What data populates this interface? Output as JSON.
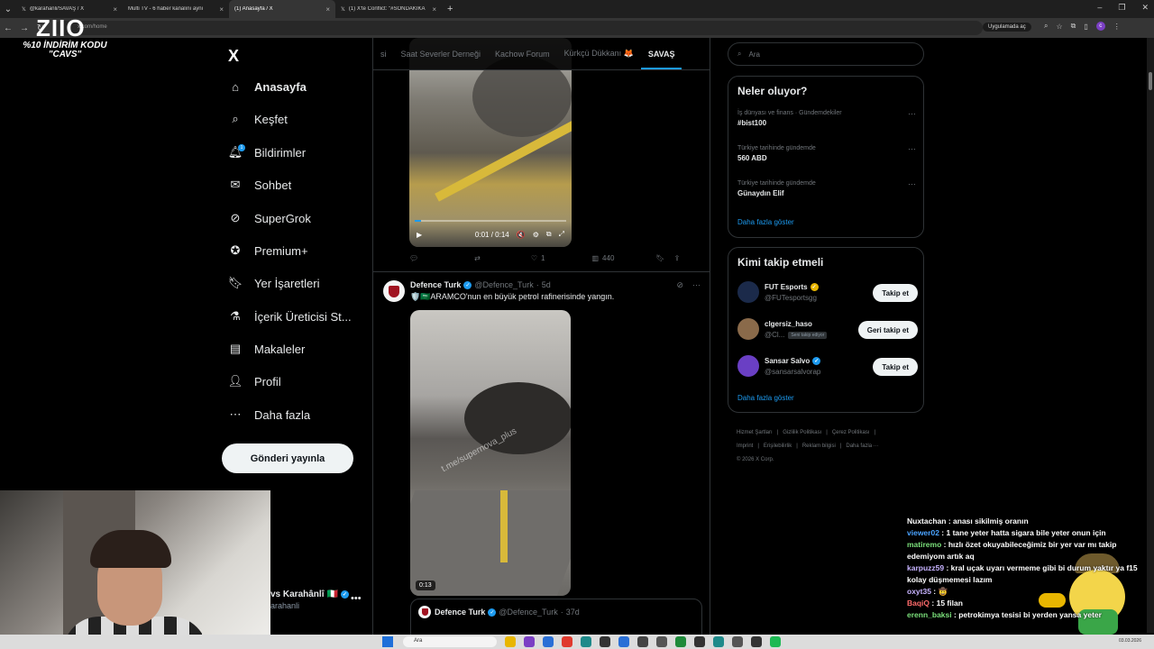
{
  "browser": {
    "tabs": [
      {
        "title": "@karahanli/SAVAŞ / X",
        "active": false
      },
      {
        "title": "Multi TV - 6 haber kanalını aynı",
        "active": false
      },
      {
        "title": "(1) Anasayfa / X",
        "active": true
      },
      {
        "title": "(1) X'te Conflict: \"#SONDAKİKA",
        "active": false
      }
    ],
    "new_tab": "+",
    "address": "x.com/home",
    "app_button": "Uygulamada aç"
  },
  "overlay": {
    "logo_text": "ZIIO",
    "promo_line1": "%10 İNDİRİM KODU",
    "promo_line2": "\"CAVS\""
  },
  "nav": {
    "logo": "X",
    "items": [
      {
        "label": "Anasayfa",
        "icon": "home-icon",
        "bold": true
      },
      {
        "label": "Keşfet",
        "icon": "search-icon"
      },
      {
        "label": "Bildirimler",
        "icon": "bell-icon"
      },
      {
        "label": "Sohbet",
        "icon": "mail-icon"
      },
      {
        "label": "SuperGrok",
        "icon": "grok-icon"
      },
      {
        "label": "Premium+",
        "icon": "premium-icon"
      },
      {
        "label": "Yer İşaretleri",
        "icon": "bookmark-icon"
      },
      {
        "label": "İçerik Üreticisi St...",
        "icon": "flask-icon"
      },
      {
        "label": "Makaleler",
        "icon": "article-icon"
      },
      {
        "label": "Profil",
        "icon": "person-icon"
      },
      {
        "label": "Daha fazla",
        "icon": "more-circle-icon"
      }
    ],
    "notifications_badge": "1",
    "post_button": "Gönderi yayınla",
    "account_name": "vs Karahânlî",
    "account_handle": "arahanli"
  },
  "timeline": {
    "tabs": [
      "si",
      "Saat Severler Derneği",
      "Kachow Forum",
      "Kürkçü Dükkanı 🦊",
      "SAVAŞ"
    ],
    "active_tab": "SAVAŞ",
    "video1": {
      "time": "0:01 / 0:14",
      "progress": 0.04
    },
    "actions1": {
      "retweets": "",
      "likes": "1",
      "views": "440"
    },
    "tweet2": {
      "author": "Defence Turk",
      "handle": "@Defence_Turk",
      "age": "5d",
      "text": "🛡️🇸🇦ARAMCO'nun en büyük petrol rafinerisinde yangın.",
      "watermark": "t.me/supernova_plus",
      "duration": "0:13"
    },
    "quote": {
      "author": "Defence Turk",
      "handle": "@Defence_Turk",
      "age": "37d"
    }
  },
  "sidebar": {
    "search_placeholder": "Ara",
    "trends_title": "Neler oluyor?",
    "trends": [
      {
        "context": "İş dünyası ve finans · Gündemdekiler",
        "topic": "#bist100"
      },
      {
        "context": "Türkiye tarihinde gündemde",
        "topic": "560 ABD"
      },
      {
        "context": "Türkiye tarihinde gündemde",
        "topic": "Günaydın Elif"
      }
    ],
    "trends_more": "Daha fazla göster",
    "follow_title": "Kimi takip etmeli",
    "who": [
      {
        "name": "FUT Esports",
        "handle": "@FUTesportsgg",
        "button": "Takip et",
        "badge": "gold",
        "avatar": "#1b2a4a",
        "follows_you": ""
      },
      {
        "name": "clgersiz_haso",
        "handle": "@Cl...",
        "button": "Geri takip et",
        "badge": "",
        "avatar": "#8a6a4a",
        "follows_you": "Seni takip ediyor"
      },
      {
        "name": "Sansar Salvo",
        "handle": "@sansarsalvorap",
        "button": "Takip et",
        "badge": "blue",
        "avatar": "#6a3fc4",
        "follows_you": ""
      }
    ],
    "follow_more": "Daha fazla göster",
    "footer_links": [
      "Hizmet Şartları",
      "|",
      "Gizlilik Politikası",
      "|",
      "Çerez Politikası",
      "|",
      "Imprint",
      "|",
      "Erişilebilirlik",
      "|",
      "Reklam bilgisi",
      "|",
      "Daha fazla ···",
      "© 2026 X Corp."
    ]
  },
  "chat": [
    {
      "user": "Nuxtachan",
      "color": "#ffffff",
      "text": "anası sikilmiş oranın"
    },
    {
      "user": "viewer02",
      "color": "#4aa3ff",
      "text": "1 tane yeter hatta sigara bile yeter onun için"
    },
    {
      "user": "matiremo",
      "color": "#7be07b",
      "text": "hızlı özet okuyabileceğimiz bir yer var mı takip edemiyom artık aq"
    },
    {
      "user": "karpuzz59",
      "color": "#c7b3ff",
      "text": "kral uçak uyarı vermeme gibi bi durum yaktır ya f15 kolay düşmemesi lazım"
    },
    {
      "user": "oxyt35",
      "color": "#c7b3ff",
      "text": "🤠"
    },
    {
      "user": "BaqiQ",
      "color": "#ff6b6b",
      "text": "15 filan"
    },
    {
      "user": "erenn_baksi",
      "color": "#7be07b",
      "text": "petrokimya tesisi bi yerden yansa yeter"
    }
  ],
  "taskbar": {
    "search_placeholder": "Ara",
    "icon_colors": [
      "#e8b600",
      "#7b3fc4",
      "#2a6fd6",
      "#e03a2e",
      "#1e8a8a",
      "#333333",
      "#2a6fd6",
      "#444444",
      "#555555",
      "#1e8a3a",
      "#333333",
      "#1e8a8a",
      "#555555",
      "#333333",
      "#1db954"
    ],
    "clock": "03.03.2026"
  }
}
